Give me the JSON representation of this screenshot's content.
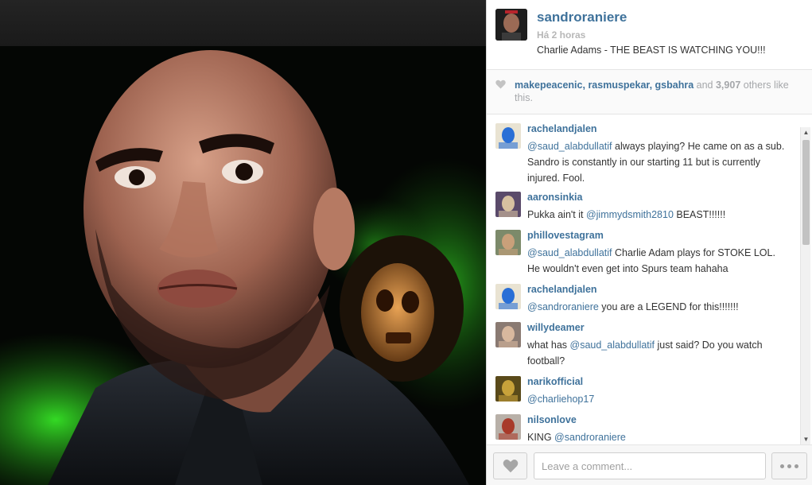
{
  "post": {
    "owner": "sandroraniere",
    "time": "Há 2 horas",
    "caption": "Charlie Adams - THE BEAST IS WATCHING YOU!!!"
  },
  "likes": {
    "users": [
      "makepeacenic",
      "rasmuspekar",
      "gsbahra"
    ],
    "sep1": ", ",
    "sep2": ", ",
    "and": " and ",
    "count": "3,907",
    "suffix": " others like this."
  },
  "comments": [
    {
      "user": "rachelandjalen",
      "parts": [
        {
          "mention": "@saud_alabdullatif"
        },
        {
          "text": " always playing? He came on as a sub. Sandro is constantly in our starting 11 but is currently injured. Fool."
        }
      ]
    },
    {
      "user": "aaronsinkia",
      "parts": [
        {
          "text": "Pukka ain't it "
        },
        {
          "mention": "@jimmydsmith2810"
        },
        {
          "text": " BEAST!!!!!!"
        }
      ]
    },
    {
      "user": "phillovestagram",
      "parts": [
        {
          "mention": "@saud_alabdullatif"
        },
        {
          "text": " Charlie Adam plays for STOKE LOL. He wouldn't even get into Spurs team hahaha"
        }
      ]
    },
    {
      "user": "rachelandjalen",
      "parts": [
        {
          "mention": "@sandroraniere"
        },
        {
          "text": " you are a LEGEND for this!!!!!!!"
        }
      ]
    },
    {
      "user": "willydeamer",
      "parts": [
        {
          "text": "what has "
        },
        {
          "mention": "@saud_alabdullatif"
        },
        {
          "text": " just said? Do you watch football?"
        }
      ]
    },
    {
      "user": "narikofficial",
      "parts": [
        {
          "mention": "@charliehop17"
        }
      ]
    },
    {
      "user": "nilsonlove",
      "parts": [
        {
          "text": "KING "
        },
        {
          "mention": "@sandroraniere"
        }
      ]
    }
  ],
  "footer": {
    "comment_placeholder": "Leave a comment..."
  },
  "icons": {
    "like": "heart-icon",
    "more": "ellipsis-icon",
    "scroll_up": "arrow-up-icon",
    "scroll_down": "arrow-down-icon"
  },
  "colors": {
    "link": "#3f729b",
    "text": "#333333",
    "muted": "#a5a7aa"
  }
}
